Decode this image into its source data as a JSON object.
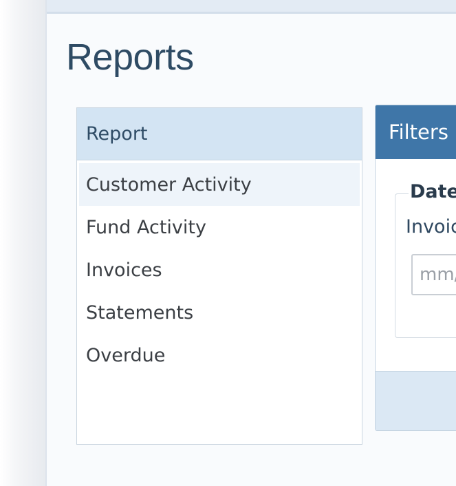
{
  "page": {
    "title": "Reports"
  },
  "report_panel": {
    "header": "Report",
    "items": [
      {
        "label": "Customer Activity",
        "active": true
      },
      {
        "label": "Fund Activity",
        "active": false
      },
      {
        "label": "Invoices",
        "active": false
      },
      {
        "label": "Statements",
        "active": false
      },
      {
        "label": "Overdue",
        "active": false
      }
    ]
  },
  "filters_panel": {
    "header": "Filters",
    "date_group": {
      "legend": "Date",
      "field_label": "Invoic",
      "input_placeholder": "mm/",
      "input_value": ""
    }
  },
  "colors": {
    "accent": "#3f76a8",
    "title": "#2e4b64",
    "panel_header_bg": "#d3e4f3",
    "active_item_bg": "#eef4fa",
    "footer_bg": "#dbe8f4"
  }
}
